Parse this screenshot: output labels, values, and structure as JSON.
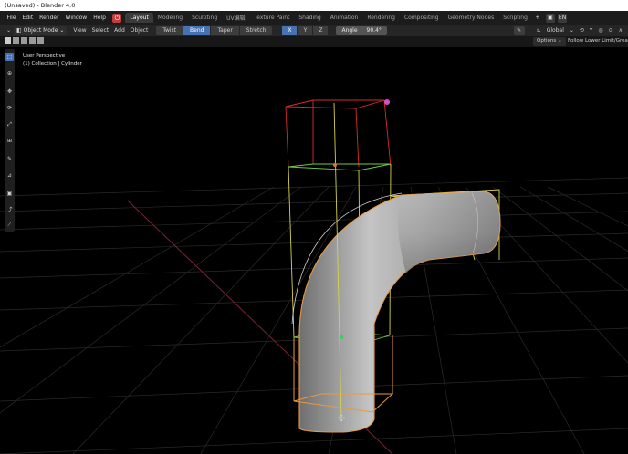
{
  "window": {
    "title": "(Unsaved) - Blender 4.0"
  },
  "menu": {
    "items": [
      "File",
      "Edit",
      "Render",
      "Window",
      "Help"
    ]
  },
  "workspaces": {
    "tabs": [
      "Layout",
      "Modeling",
      "Sculpting",
      "UV编辑",
      "Texture Paint",
      "Shading",
      "Animation",
      "Rendering",
      "Compositing",
      "Geometry Nodes",
      "Scripting"
    ],
    "active": "Layout",
    "add_label": "+",
    "language": "EN"
  },
  "header": {
    "mode": "Object Mode",
    "menus": [
      "View",
      "Select",
      "Add",
      "Object"
    ],
    "deform_modes": [
      "Twist",
      "Bend",
      "Taper",
      "Stretch"
    ],
    "active_deform": "Bend",
    "axes": [
      "X",
      "Y",
      "Z"
    ],
    "active_axis": "X",
    "angle_label": "Angle",
    "angle_value": "90.4°",
    "orientation": "Global"
  },
  "subheader": {
    "options_label": "Options",
    "follow_label": "Follow Lower Limit/Greater"
  },
  "viewport": {
    "view_name": "User Perspective",
    "collection_info": "(1) Collection | Cylinder"
  },
  "icons": {
    "power": "power-icon",
    "eyedropper": "eyedropper-icon",
    "transform_orientation": "axes-icon",
    "pivot": "pivot-icon",
    "snap": "magnet-icon",
    "proportional": "proportional-icon"
  },
  "colors": {
    "accent": "#4772b3",
    "grid": "#2b2b2b",
    "axis_x": "#8a2a34",
    "bbox_red": "#d62c2c",
    "bbox_green": "#72c84a",
    "bbox_yellow": "#d8d24a",
    "outline": "#e79a40",
    "mesh": "#9a9a9a"
  }
}
